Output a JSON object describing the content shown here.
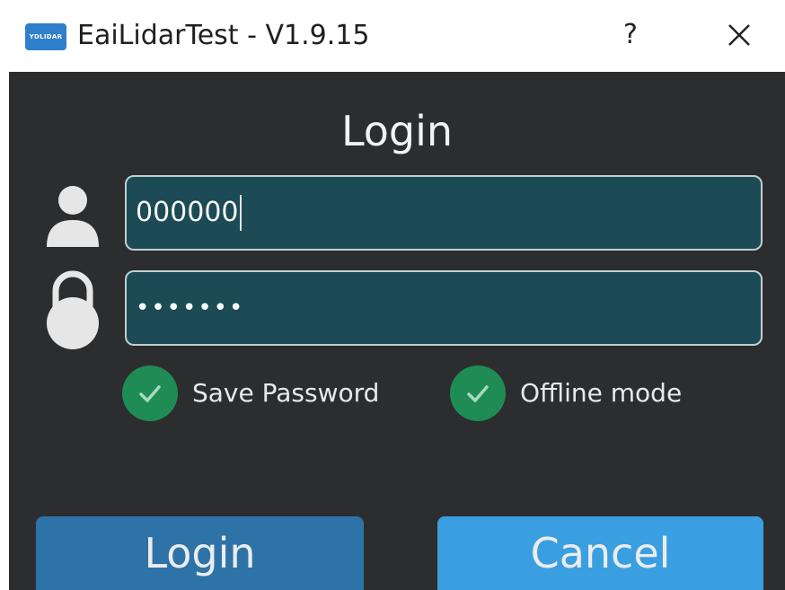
{
  "window": {
    "app_icon_label": "YDLIDAR",
    "title": "EaiLidarTest - V1.9.15",
    "help_label": "?",
    "close_label": "×"
  },
  "dialog": {
    "heading": "Login",
    "username": {
      "value": "000000",
      "icon": "user-icon"
    },
    "password": {
      "masked_value": "•••••••",
      "icon": "lock-icon"
    },
    "options": [
      {
        "label": "Save Password",
        "checked": true
      },
      {
        "label": "Offline mode",
        "checked": true
      }
    ],
    "buttons": {
      "login_label": "Login",
      "cancel_label": "Cancel"
    }
  },
  "colors": {
    "background": "#2c2d2f",
    "field": "#1c4b55",
    "check": "#1f8c55",
    "login_button": "#2e73a8",
    "cancel_button": "#3a9fe0"
  }
}
